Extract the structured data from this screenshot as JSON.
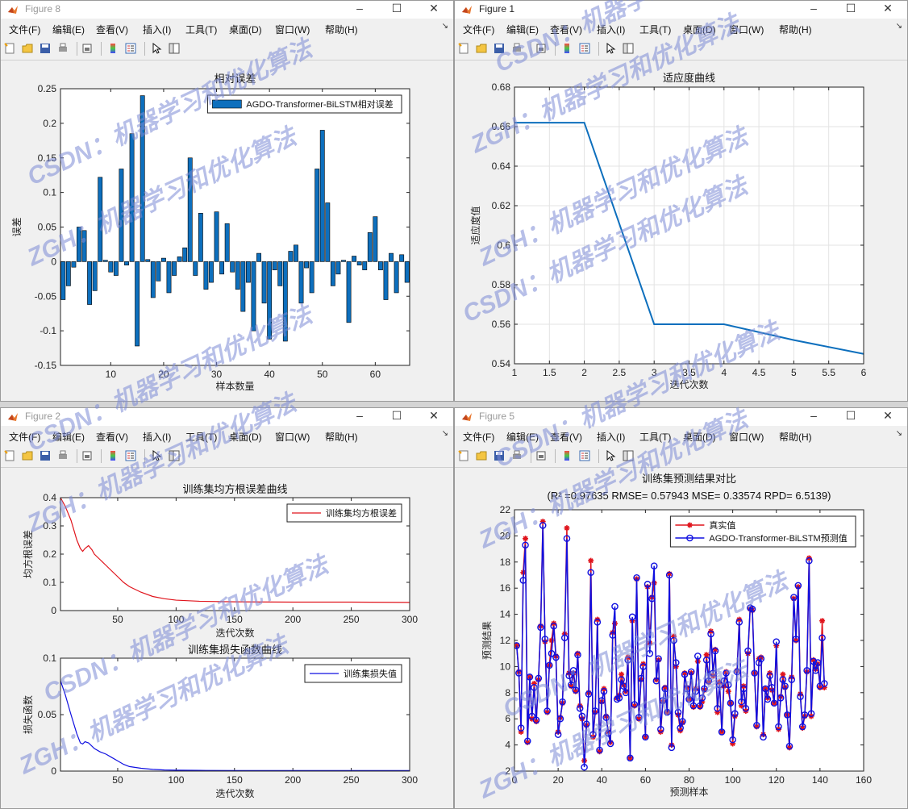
{
  "windows": {
    "tl": {
      "title": "Figure 8"
    },
    "tr": {
      "title": "Figure 1"
    },
    "bl": {
      "title": "Figure 2"
    },
    "br": {
      "title": "Figure 5"
    }
  },
  "menu": [
    "文件(F)",
    "编辑(E)",
    "查看(V)",
    "插入(I)",
    "工具(T)",
    "桌面(D)",
    "窗口(W)",
    "帮助(H)"
  ],
  "toolbar_icons": [
    "new-icon",
    "open-icon",
    "save-icon",
    "print-icon",
    "print-preview-icon",
    "colorbar-icon",
    "legend-icon",
    "pointer-icon",
    "property-editor-icon"
  ],
  "watermark": {
    "lines": [
      "ZGH：机器学习和优化算法",
      "CSDN：机器学习和优化算法"
    ],
    "color": "#7c8bd6"
  },
  "chart_data": [
    {
      "id": "relative-error",
      "type": "bar",
      "title": "相对误差",
      "xlabel": "样本数量",
      "ylabel": "误差",
      "xlim": [
        0.5,
        66.5
      ],
      "ylim": [
        -0.15,
        0.25
      ],
      "xticks": [
        10,
        20,
        30,
        40,
        50,
        60
      ],
      "yticks": [
        -0.15,
        -0.1,
        -0.05,
        0,
        0.05,
        0.1,
        0.15,
        0.2,
        0.25
      ],
      "grid": false,
      "legend": {
        "position": "top-right",
        "entries": [
          "AGDO-Transformer-BiLSTM相对误差"
        ]
      },
      "color": "#0d6fbd",
      "x": [
        1,
        2,
        3,
        4,
        5,
        6,
        7,
        8,
        9,
        10,
        11,
        12,
        13,
        14,
        15,
        16,
        17,
        18,
        19,
        20,
        21,
        22,
        23,
        24,
        25,
        26,
        27,
        28,
        29,
        30,
        31,
        32,
        33,
        34,
        35,
        36,
        37,
        38,
        39,
        40,
        41,
        42,
        43,
        44,
        45,
        46,
        47,
        48,
        49,
        50,
        51,
        52,
        53,
        54,
        55,
        56,
        57,
        58,
        59,
        60,
        61,
        62,
        63,
        64,
        65,
        66
      ],
      "values": [
        -0.055,
        -0.035,
        -0.008,
        0.05,
        0.045,
        -0.062,
        -0.042,
        0.122,
        0.002,
        -0.015,
        -0.02,
        0.134,
        -0.005,
        0.185,
        -0.122,
        0.24,
        0.003,
        -0.052,
        -0.028,
        0.005,
        -0.045,
        -0.02,
        0.007,
        0.02,
        0.15,
        -0.02,
        0.07,
        -0.04,
        -0.03,
        0.072,
        -0.018,
        0.055,
        -0.015,
        -0.04,
        -0.072,
        -0.03,
        -0.1,
        0.012,
        -0.06,
        -0.112,
        -0.012,
        -0.035,
        -0.115,
        0.015,
        0.024,
        -0.06,
        -0.009,
        -0.045,
        0.134,
        0.19,
        0.085,
        -0.035,
        -0.018,
        0.002,
        -0.088,
        0.008,
        -0.005,
        -0.012,
        0.042,
        0.065,
        -0.012,
        -0.055,
        0.012,
        -0.045,
        0.01,
        -0.03
      ]
    },
    {
      "id": "fitness-curve",
      "type": "line",
      "title": "适应度曲线",
      "xlabel": "迭代次数",
      "ylabel": "适应度值",
      "xlim": [
        1,
        6
      ],
      "ylim": [
        0.54,
        0.68
      ],
      "xticks": [
        1,
        1.5,
        2,
        2.5,
        3,
        3.5,
        4,
        4.5,
        5,
        5.5,
        6
      ],
      "yticks": [
        0.54,
        0.56,
        0.58,
        0.6,
        0.62,
        0.64,
        0.66,
        0.68
      ],
      "grid": true,
      "color": "#0d6fbd",
      "x": [
        1,
        2,
        3,
        4,
        5,
        6
      ],
      "y": [
        0.662,
        0.662,
        0.56,
        0.56,
        0.552,
        0.545
      ]
    },
    {
      "id": "train-rmse",
      "type": "line",
      "title": "训练集均方根误差曲线",
      "xlabel": "迭代次数",
      "ylabel": "均方根误差",
      "xlim": [
        1,
        300
      ],
      "ylim": [
        0,
        0.4
      ],
      "xticks": [
        50,
        100,
        150,
        200,
        250,
        300
      ],
      "yticks": [
        0,
        0.1,
        0.2,
        0.3,
        0.4
      ],
      "grid": false,
      "legend": {
        "position": "top-right",
        "entries": [
          "训练集均方根误差"
        ]
      },
      "color": "#e0141c",
      "x": [
        1,
        5,
        10,
        15,
        18,
        20,
        22,
        25,
        28,
        30,
        35,
        40,
        45,
        50,
        55,
        60,
        70,
        80,
        90,
        100,
        120,
        150,
        200,
        250,
        300
      ],
      "y": [
        0.4,
        0.37,
        0.32,
        0.25,
        0.22,
        0.21,
        0.22,
        0.23,
        0.215,
        0.2,
        0.18,
        0.16,
        0.14,
        0.12,
        0.1,
        0.085,
        0.065,
        0.05,
        0.042,
        0.037,
        0.033,
        0.031,
        0.03,
        0.03,
        0.029
      ]
    },
    {
      "id": "train-loss",
      "type": "line",
      "title": "训练集损失函数曲线",
      "xlabel": "迭代次数",
      "ylabel": "损失函数",
      "xlim": [
        1,
        300
      ],
      "ylim": [
        0,
        0.1
      ],
      "xticks": [
        50,
        100,
        150,
        200,
        250,
        300
      ],
      "yticks": [
        0,
        0.05,
        0.1
      ],
      "grid": false,
      "legend": {
        "position": "top-right",
        "entries": [
          "训练集损失值"
        ]
      },
      "color": "#1010e0",
      "x": [
        1,
        5,
        10,
        15,
        18,
        20,
        22,
        25,
        28,
        30,
        35,
        40,
        45,
        50,
        55,
        60,
        70,
        80,
        90,
        100,
        120,
        150,
        200,
        250,
        300
      ],
      "y": [
        0.08,
        0.068,
        0.05,
        0.033,
        0.025,
        0.024,
        0.026,
        0.025,
        0.022,
        0.02,
        0.017,
        0.015,
        0.012,
        0.009,
        0.006,
        0.004,
        0.0025,
        0.0015,
        0.001,
        0.0008,
        0.0006,
        0.0005,
        0.0005,
        0.0005,
        0.0005
      ]
    },
    {
      "id": "train-prediction",
      "type": "line",
      "title": "训练集预测结果对比",
      "subtitle": "(R² =0.97635 RMSE= 0.57943 MSE= 0.33574 RPD= 6.5139)",
      "xlabel": "预测样本",
      "ylabel": "预测结果",
      "xlim": [
        0,
        160
      ],
      "ylim": [
        2,
        22
      ],
      "xticks": [
        0,
        20,
        40,
        60,
        80,
        100,
        120,
        140,
        160
      ],
      "yticks": [
        2,
        4,
        6,
        8,
        10,
        12,
        14,
        16,
        18,
        20,
        22
      ],
      "grid": false,
      "legend": {
        "position": "top-right",
        "entries": [
          "真实值",
          "AGDO-Transformer-BiLSTM预测值"
        ]
      },
      "series": [
        {
          "name": "真实值",
          "color": "#e0141c",
          "marker": "asterisk",
          "y": [
            11.6,
            9.6,
            5.0,
            17.2,
            19.8,
            4.2,
            9.2,
            6.0,
            8.7,
            5.8,
            9.0,
            13.1,
            21.1,
            11.9,
            6.5,
            10.1,
            12.0,
            13.3,
            10.8,
            5.0,
            6.1,
            7.2,
            12.5,
            20.6,
            9.5,
            8.5,
            9.5,
            8.1,
            11.0,
            7.0,
            6.0,
            2.8,
            5.5,
            8.0,
            18.1,
            4.6,
            6.5,
            13.6,
            3.5,
            7.3,
            8.3,
            6.2,
            5.0,
            4.2,
            12.6,
            13.3,
            7.6,
            7.8,
            9.4,
            8.6,
            8.1,
            10.7,
            3.0,
            13.5,
            7.0,
            16.7,
            6.0,
            9.0,
            10.2,
            4.6,
            16.1,
            11.8,
            15.3,
            16.4,
            9.0,
            10.5,
            5.0,
            7.3,
            8.4,
            6.5,
            17.1,
            4.0,
            12.3,
            10.0,
            6.3,
            5.1,
            5.7,
            9.5,
            8.4,
            7.5,
            9.5,
            6.9,
            8.3,
            10.4,
            6.9,
            7.3,
            8.2,
            10.9,
            8.8,
            12.7,
            9.3,
            11.3,
            6.5,
            8.8,
            5.0,
            8.5,
            9.6,
            8.1,
            7.2,
            4.1,
            6.2,
            9.7,
            13.6,
            7.0,
            8.5,
            6.6,
            11.0,
            14.4,
            14.3,
            9.5,
            5.4,
            10.6,
            10.7,
            4.8,
            8.3,
            7.6,
            9.5,
            8.2,
            7.2,
            11.6,
            5.2,
            7.7,
            9.4,
            8.4,
            6.3,
            3.8,
            9.2,
            15.2,
            12.0,
            16.1,
            7.9,
            5.3,
            6.2,
            9.6,
            18.3,
            6.2,
            10.5,
            9.8,
            10.2,
            8.4,
            13.5,
            8.4
          ]
        },
        {
          "name": "AGDO-Transformer-BiLSTM预测值",
          "color": "#1010e0",
          "marker": "circle",
          "y": [
            11.6,
            9.5,
            5.3,
            16.6,
            19.3,
            4.3,
            9.2,
            6.2,
            8.4,
            5.9,
            9.1,
            13.0,
            20.8,
            12.1,
            6.6,
            10.1,
            11.0,
            13.1,
            10.7,
            4.8,
            6.0,
            7.3,
            12.2,
            19.8,
            9.3,
            8.6,
            9.7,
            8.2,
            10.9,
            6.8,
            6.2,
            2.3,
            5.6,
            7.9,
            17.2,
            4.8,
            6.6,
            13.4,
            3.6,
            7.4,
            8.1,
            6.1,
            4.9,
            4.1,
            12.4,
            14.6,
            7.5,
            7.6,
            9.0,
            8.5,
            8.0,
            10.5,
            3.0,
            13.8,
            7.1,
            16.8,
            6.1,
            9.1,
            10.0,
            4.6,
            16.3,
            11.0,
            15.2,
            17.7,
            8.9,
            10.6,
            5.2,
            7.4,
            8.3,
            6.5,
            17.0,
            3.8,
            12.0,
            10.3,
            6.5,
            5.3,
            5.8,
            9.4,
            8.3,
            7.5,
            9.6,
            7.0,
            8.1,
            10.8,
            7.0,
            7.6,
            8.3,
            10.5,
            8.9,
            12.5,
            9.5,
            11.2,
            6.8,
            8.6,
            5.0,
            8.9,
            9.5,
            8.6,
            7.2,
            4.4,
            6.4,
            9.6,
            13.4,
            7.3,
            8.3,
            6.8,
            11.2,
            14.5,
            14.4,
            9.5,
            5.5,
            10.3,
            10.6,
            4.6,
            8.3,
            7.5,
            9.3,
            8.4,
            7.2,
            11.9,
            5.4,
            7.6,
            9.0,
            8.5,
            6.3,
            3.9,
            9.0,
            15.3,
            12.1,
            16.2,
            7.7,
            5.4,
            6.3,
            9.7,
            18.1,
            6.4,
            10.4,
            9.7,
            10.3,
            8.5,
            12.2,
            8.7
          ]
        }
      ]
    }
  ]
}
